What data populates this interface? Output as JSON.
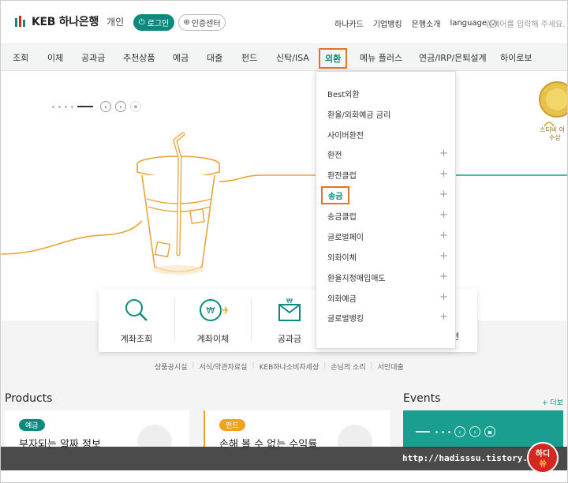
{
  "header": {
    "logo_text": "KEB 하나은행",
    "logo_sub": "개인",
    "login_label": "로그인",
    "cert_label": "인증센터",
    "links": [
      "하나카드",
      "기업뱅킹",
      "은행소개"
    ],
    "language_label": "language",
    "search_placeholder": "검색어를 입력해 주세요."
  },
  "nav": {
    "items": [
      "조회",
      "이체",
      "공과금",
      "추천상품",
      "예금",
      "대출",
      "펀드",
      "신탁/ISA",
      "외환",
      "메뉴 플러스",
      "연금/IRP/은퇴설계",
      "하이로보"
    ],
    "active_index": 8
  },
  "dropdown": {
    "items": [
      {
        "label": "Best외환",
        "plus": false
      },
      {
        "label": "환율/외화예금 금리",
        "plus": false
      },
      {
        "label": "사이버환전",
        "plus": false
      },
      {
        "label": "환전",
        "plus": true
      },
      {
        "label": "환전클럽",
        "plus": true
      },
      {
        "label": "송금",
        "plus": true
      },
      {
        "label": "송금클럽",
        "plus": true
      },
      {
        "label": "글로벌페이",
        "plus": true
      },
      {
        "label": "외화이체",
        "plus": true
      },
      {
        "label": "환율지정매입매도",
        "plus": true
      },
      {
        "label": "외화예금",
        "plus": true
      },
      {
        "label": "글로벌뱅킹",
        "plus": true
      }
    ],
    "active_index": 5
  },
  "hero": {
    "medal_text_1": "스티비 어",
    "medal_text_2": "수상"
  },
  "quick": {
    "items": [
      "계좌조회",
      "계좌이체",
      "공과금"
    ],
    "partial_label": "편"
  },
  "footer_links": [
    "상품공시실",
    "서식/약관자료실",
    "KEB하나소비자세상",
    "손님의 소리",
    "서민대출"
  ],
  "products": {
    "title": "Products",
    "cards": [
      {
        "badge": "예금",
        "title": "부자되는 알짜 정보"
      },
      {
        "badge": "펀드",
        "title": "손해 볼 수 없는 수익률"
      }
    ]
  },
  "events": {
    "title": "Events",
    "more_label": "+ 더보"
  },
  "watermark": {
    "url": "http://hadisssu.tistory.com",
    "logo_line1": "하디",
    "logo_line2": "쓔"
  },
  "colors": {
    "brand": "#0d8a7e",
    "highlight": "#e8702a",
    "accent_orange": "#f0a31c"
  }
}
